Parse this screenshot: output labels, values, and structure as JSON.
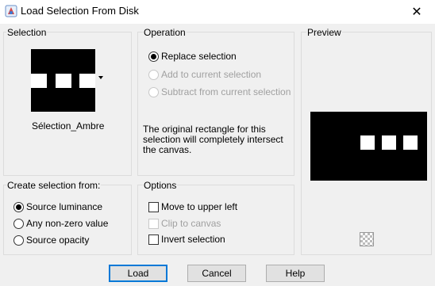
{
  "window": {
    "title": "Load Selection From Disk",
    "close_glyph": "✕"
  },
  "selection": {
    "label": "Selection",
    "name": "Sélection_Ambre"
  },
  "operation": {
    "label": "Operation",
    "options": [
      "Replace selection",
      "Add to current selection",
      "Subtract from current selection"
    ],
    "selected_index": 0,
    "description": "The original rectangle for this selection will completely intersect the canvas."
  },
  "preview": {
    "label": "Preview"
  },
  "create_from": {
    "label": "Create selection from:",
    "options": [
      "Source luminance",
      "Any non-zero value",
      "Source opacity"
    ],
    "selected_index": 0
  },
  "options": {
    "label": "Options",
    "items": [
      {
        "label": "Move to upper left",
        "checked": false,
        "enabled": true
      },
      {
        "label": "Clip to canvas",
        "checked": false,
        "enabled": false
      },
      {
        "label": "Invert selection",
        "checked": false,
        "enabled": true
      }
    ]
  },
  "buttons": {
    "load": "Load",
    "cancel": "Cancel",
    "help": "Help"
  },
  "icons": {
    "app": "app-icon",
    "close": "close-icon",
    "checkerboard": "checkerboard-icon",
    "dropdown": "chevron-down-icon"
  },
  "colors": {
    "default_button_border": "#0078d7",
    "disabled_text": "#a0a0a0",
    "thumbnail_bg": "#000000"
  }
}
